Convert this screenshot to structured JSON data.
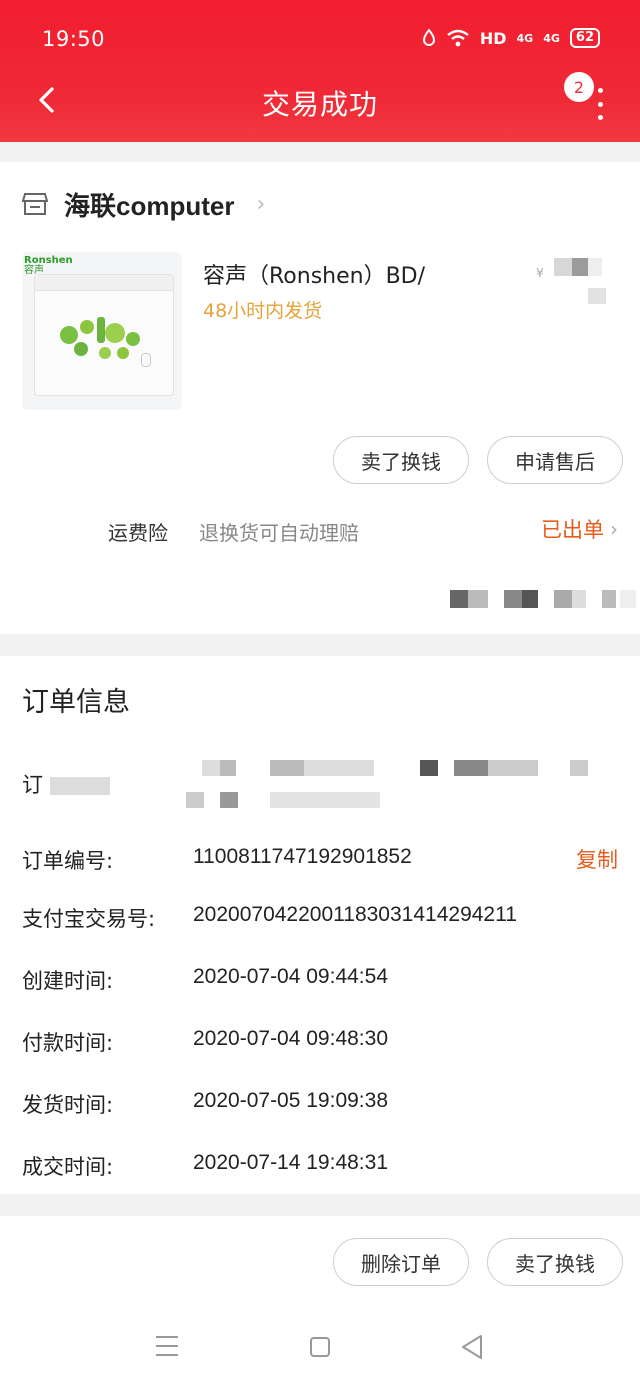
{
  "status_bar": {
    "time": "19:50",
    "network": "HD",
    "signal_1": "4G",
    "signal_2": "4G",
    "battery": "62"
  },
  "nav": {
    "title": "交易成功",
    "badge_count": "2"
  },
  "shop": {
    "name": "海联computer"
  },
  "product": {
    "brand_logo_en": "Ronshen",
    "brand_logo_cn": "容声",
    "title": "容声（Ronshen）BD/",
    "price_symbol": "¥",
    "shipping_note": "48小时内发货"
  },
  "actions": {
    "sell_label": "卖了换钱",
    "after_sale_label": "申请售后"
  },
  "insurance": {
    "label": "运费险",
    "description": "退换货可自动理赔",
    "status": "已出单"
  },
  "order_info": {
    "title": "订单信息",
    "address_label_prefix": "订",
    "rows": [
      {
        "label": "订单编号:",
        "value": "1100811747192901852"
      },
      {
        "label": "支付宝交易号:",
        "value": "2020070422001183031414294211"
      },
      {
        "label": "创建时间:",
        "value": "2020-07-04 09:44:54"
      },
      {
        "label": "付款时间:",
        "value": "2020-07-04 09:48:30"
      },
      {
        "label": "发货时间:",
        "value": "2020-07-05 19:09:38"
      },
      {
        "label": "成交时间:",
        "value": "2020-07-14 19:48:31"
      }
    ],
    "copy_label": "复制"
  },
  "footer": {
    "delete_label": "删除订单",
    "sell_label": "卖了换钱"
  },
  "colors": {
    "header_red": "#f21d2f",
    "accent_orange": "#e65c1b",
    "shipping_yellow": "#e5a33a"
  }
}
